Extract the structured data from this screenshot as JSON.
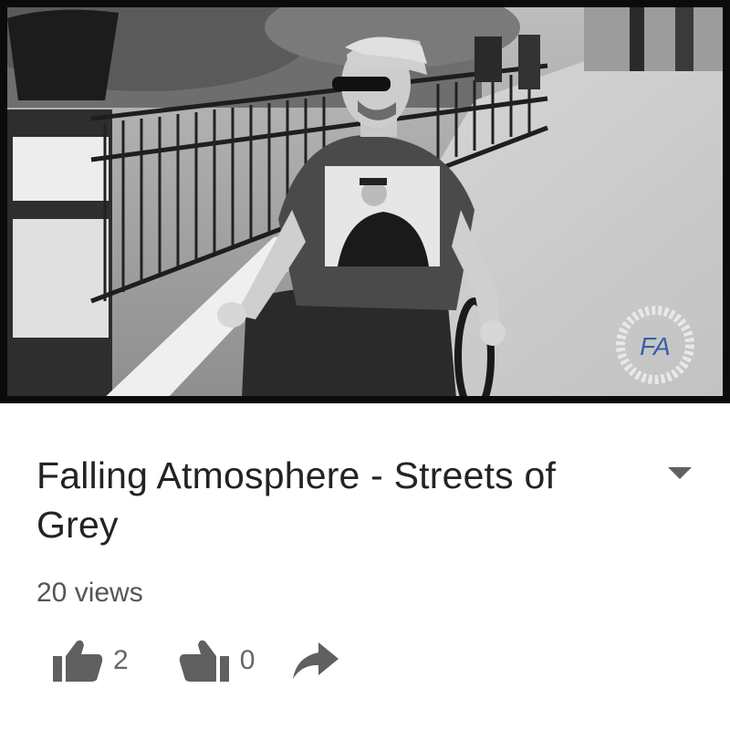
{
  "video": {
    "thumbnail_icon": "video-frame-image",
    "watermark_text": "FA"
  },
  "title": "Falling Atmosphere - Streets of Grey",
  "views": "20 views",
  "actions": {
    "like_count": "2",
    "dislike_count": "0"
  },
  "icons": {
    "expand": "chevron-down-icon",
    "like": "thumbs-up-icon",
    "dislike": "thumbs-down-icon",
    "share": "share-icon"
  },
  "colors": {
    "text": "#232323",
    "secondary": "#666666",
    "icon": "#606060",
    "watermark": "#3a5fa8"
  }
}
